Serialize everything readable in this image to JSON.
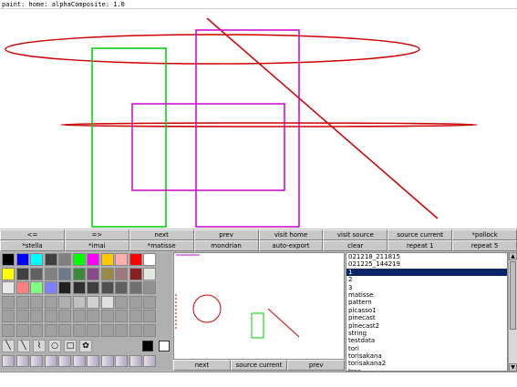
{
  "title": "paint: home: alphaComposite: 1.0",
  "toolbar_row1": [
    "<=",
    "=>",
    "next",
    "prev",
    "visit home",
    "visit source",
    "source current",
    "*pollock"
  ],
  "toolbar_row2": [
    "*stella",
    "*imai",
    "*matisse",
    "mondrian",
    "auto-export",
    "clear",
    "repeat 1",
    "repeat 5"
  ],
  "palette": {
    "colors": [
      [
        "#000000",
        "#0000ff",
        "#00ffff",
        "#404040",
        "#808080",
        "#00ff00",
        "#ff00ff",
        "#ffc800",
        "#ffafaf",
        "#ff0000",
        "#ffffff"
      ],
      [
        "#ffff00",
        "#404040",
        "#606060",
        "#808080",
        "#6a7a8a",
        "#3a8a3a",
        "#8a4a8a",
        "#9a8a4a",
        "#9a7a7a",
        "#8a2020",
        "#e0e8e0"
      ],
      [
        "#e8e8e8",
        "#ff8080",
        "#80ff80",
        "#8080ff",
        "#202020",
        "#303030",
        "#404040",
        "#505050",
        "#606060",
        "#707070",
        "#909090"
      ],
      [
        "#a0a0a0",
        "#a0a0a0",
        "#a0a0a0",
        "#a0a0a0",
        "#b0b0b0",
        "#c0c0c0",
        "#d0d0d0",
        "#e0e0e0",
        "#a0a0a0",
        "#a0a0a0",
        "#a0a0a0"
      ],
      [
        "#a0a0a0",
        "#a0a0a0",
        "#a0a0a0",
        "#a0a0a0",
        "#a0a0a0",
        "#a0a0a0",
        "#a0a0a0",
        "#a0a0a0",
        "#a0a0a0",
        "#a0a0a0",
        "#a0a0a0"
      ],
      [
        "#a0a0a0",
        "#a0a0a0",
        "#a0a0a0",
        "#a0a0a0",
        "#a0a0a0",
        "#a0a0a0",
        "#a0a0a0",
        "#a0a0a0",
        "#a0a0a0",
        "#a0a0a0",
        "#a0a0a0"
      ]
    ],
    "tools": [
      "pen-icon",
      "line-icon",
      "curve-icon",
      "ellipse-icon",
      "rectangle-icon",
      "image-icon"
    ],
    "tool_glyphs": [
      "╲",
      "╲",
      "⌇",
      "○",
      "□",
      "✿"
    ]
  },
  "preview_buttons": [
    "next",
    "source current",
    "prev"
  ],
  "file_list": {
    "items": [
      "021218_211815",
      "021225_144219",
      "1",
      "2",
      "3",
      "matisse",
      "pattern",
      "picasso1",
      "pinecast",
      "pinecast2",
      "string",
      "testdata",
      "tori",
      "torisakana",
      "torisakana2",
      "tree"
    ],
    "selected_index": 2
  },
  "status": "",
  "colors": {
    "red": "#cc0000",
    "green": "#00cc00",
    "magenta": "#cc00cc",
    "selection": "#0a246a"
  }
}
